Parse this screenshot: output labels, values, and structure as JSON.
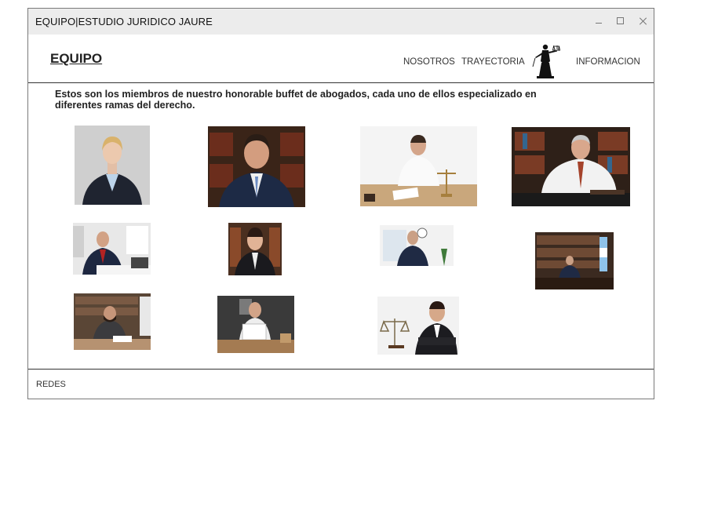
{
  "window": {
    "title": "EQUIPO|ESTUDIO JURIDICO JAURE"
  },
  "header": {
    "brand": "EQUIPO",
    "nav": [
      {
        "label": "NOSOTROS"
      },
      {
        "label": "TRAYECTORIA"
      },
      {
        "label": "INFORMACION"
      }
    ]
  },
  "content": {
    "intro": "Estos son los miembros de nuestro honorable buffet de abogados, cada uno de ellos especializado en diferentes ramas del derecho."
  },
  "footer": {
    "label": "REDES"
  }
}
